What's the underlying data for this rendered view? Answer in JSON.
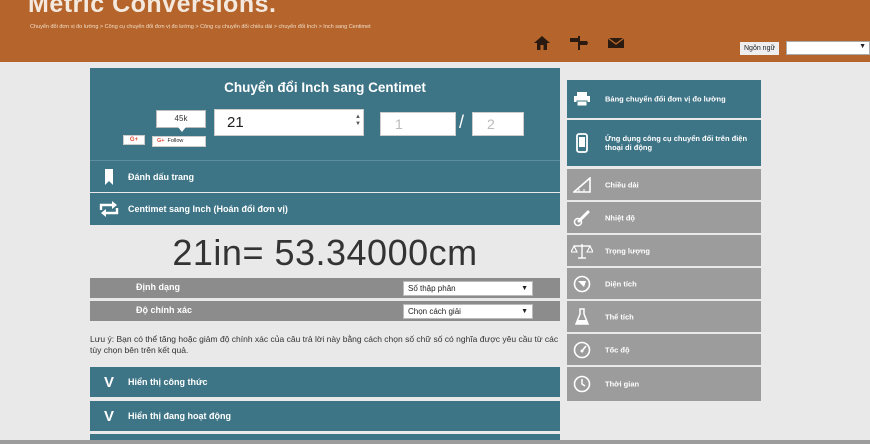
{
  "header": {
    "site_title": "Metric Conversions.",
    "breadcrumb": "Chuyển đổi đơn vị đo lường > Công cụ chuyển đổi đơn vị đo lường > Công cụ chuyển đổi chiều dài > chuyển đổi Inch > Inch sang Centimet",
    "language_label": "Ngôn ngữ",
    "language_value": ""
  },
  "converter": {
    "title": "Chuyển đổi Inch sang Centimet",
    "social_count": "45k",
    "gplus_label": "G+",
    "follow_label": "Follow",
    "input_value": "21",
    "fraction_numerator": "1",
    "fraction_separator": "/",
    "fraction_denominator": "2",
    "bookmark_label": "Đánh dấu trang",
    "swap_label": "Centimet sang Inch (Hoán đổi đơn vị)",
    "result": "21in= 53.34000cm"
  },
  "options": {
    "format_label": "Định dạng",
    "format_value": "Số thập phân",
    "precision_label": "Độ chính xác",
    "precision_value": "Chọn cách giải"
  },
  "note": "Lưu ý: Bạn có thể tăng hoặc giảm độ chính xác của câu trả lời này bằng cách chọn số chữ số có nghĩa được yêu cầu từ các tùy chọn bên trên kết quả.",
  "expanders": {
    "formula_icon": "V",
    "formula_label": "Hiển thị công thức",
    "working_icon": "V",
    "working_label": "Hiển thị đang hoạt động"
  },
  "sidebar": {
    "items": [
      {
        "label": "Bảng chuyển đổi đơn vị đo lường",
        "icon": "printer-icon"
      },
      {
        "label": "Ứng dụng công cụ chuyển đổi trên điện thoại di động",
        "icon": "phone-icon"
      },
      {
        "label": "Chiều dài",
        "icon": "ruler-icon"
      },
      {
        "label": "Nhiệt độ",
        "icon": "thermometer-icon"
      },
      {
        "label": "Trọng lượng",
        "icon": "scale-icon"
      },
      {
        "label": "Diện tích",
        "icon": "area-icon"
      },
      {
        "label": "Thể tích",
        "icon": "flask-icon"
      },
      {
        "label": "Tốc độ",
        "icon": "speedometer-icon"
      },
      {
        "label": "Thời gian",
        "icon": "clock-icon"
      }
    ]
  },
  "colors": {
    "header_brown": "#b5652b",
    "panel_teal": "#3d7486",
    "option_grey": "#8c8c8c",
    "side_grey": "#9c9c9c",
    "background": "#e9e9e9"
  }
}
